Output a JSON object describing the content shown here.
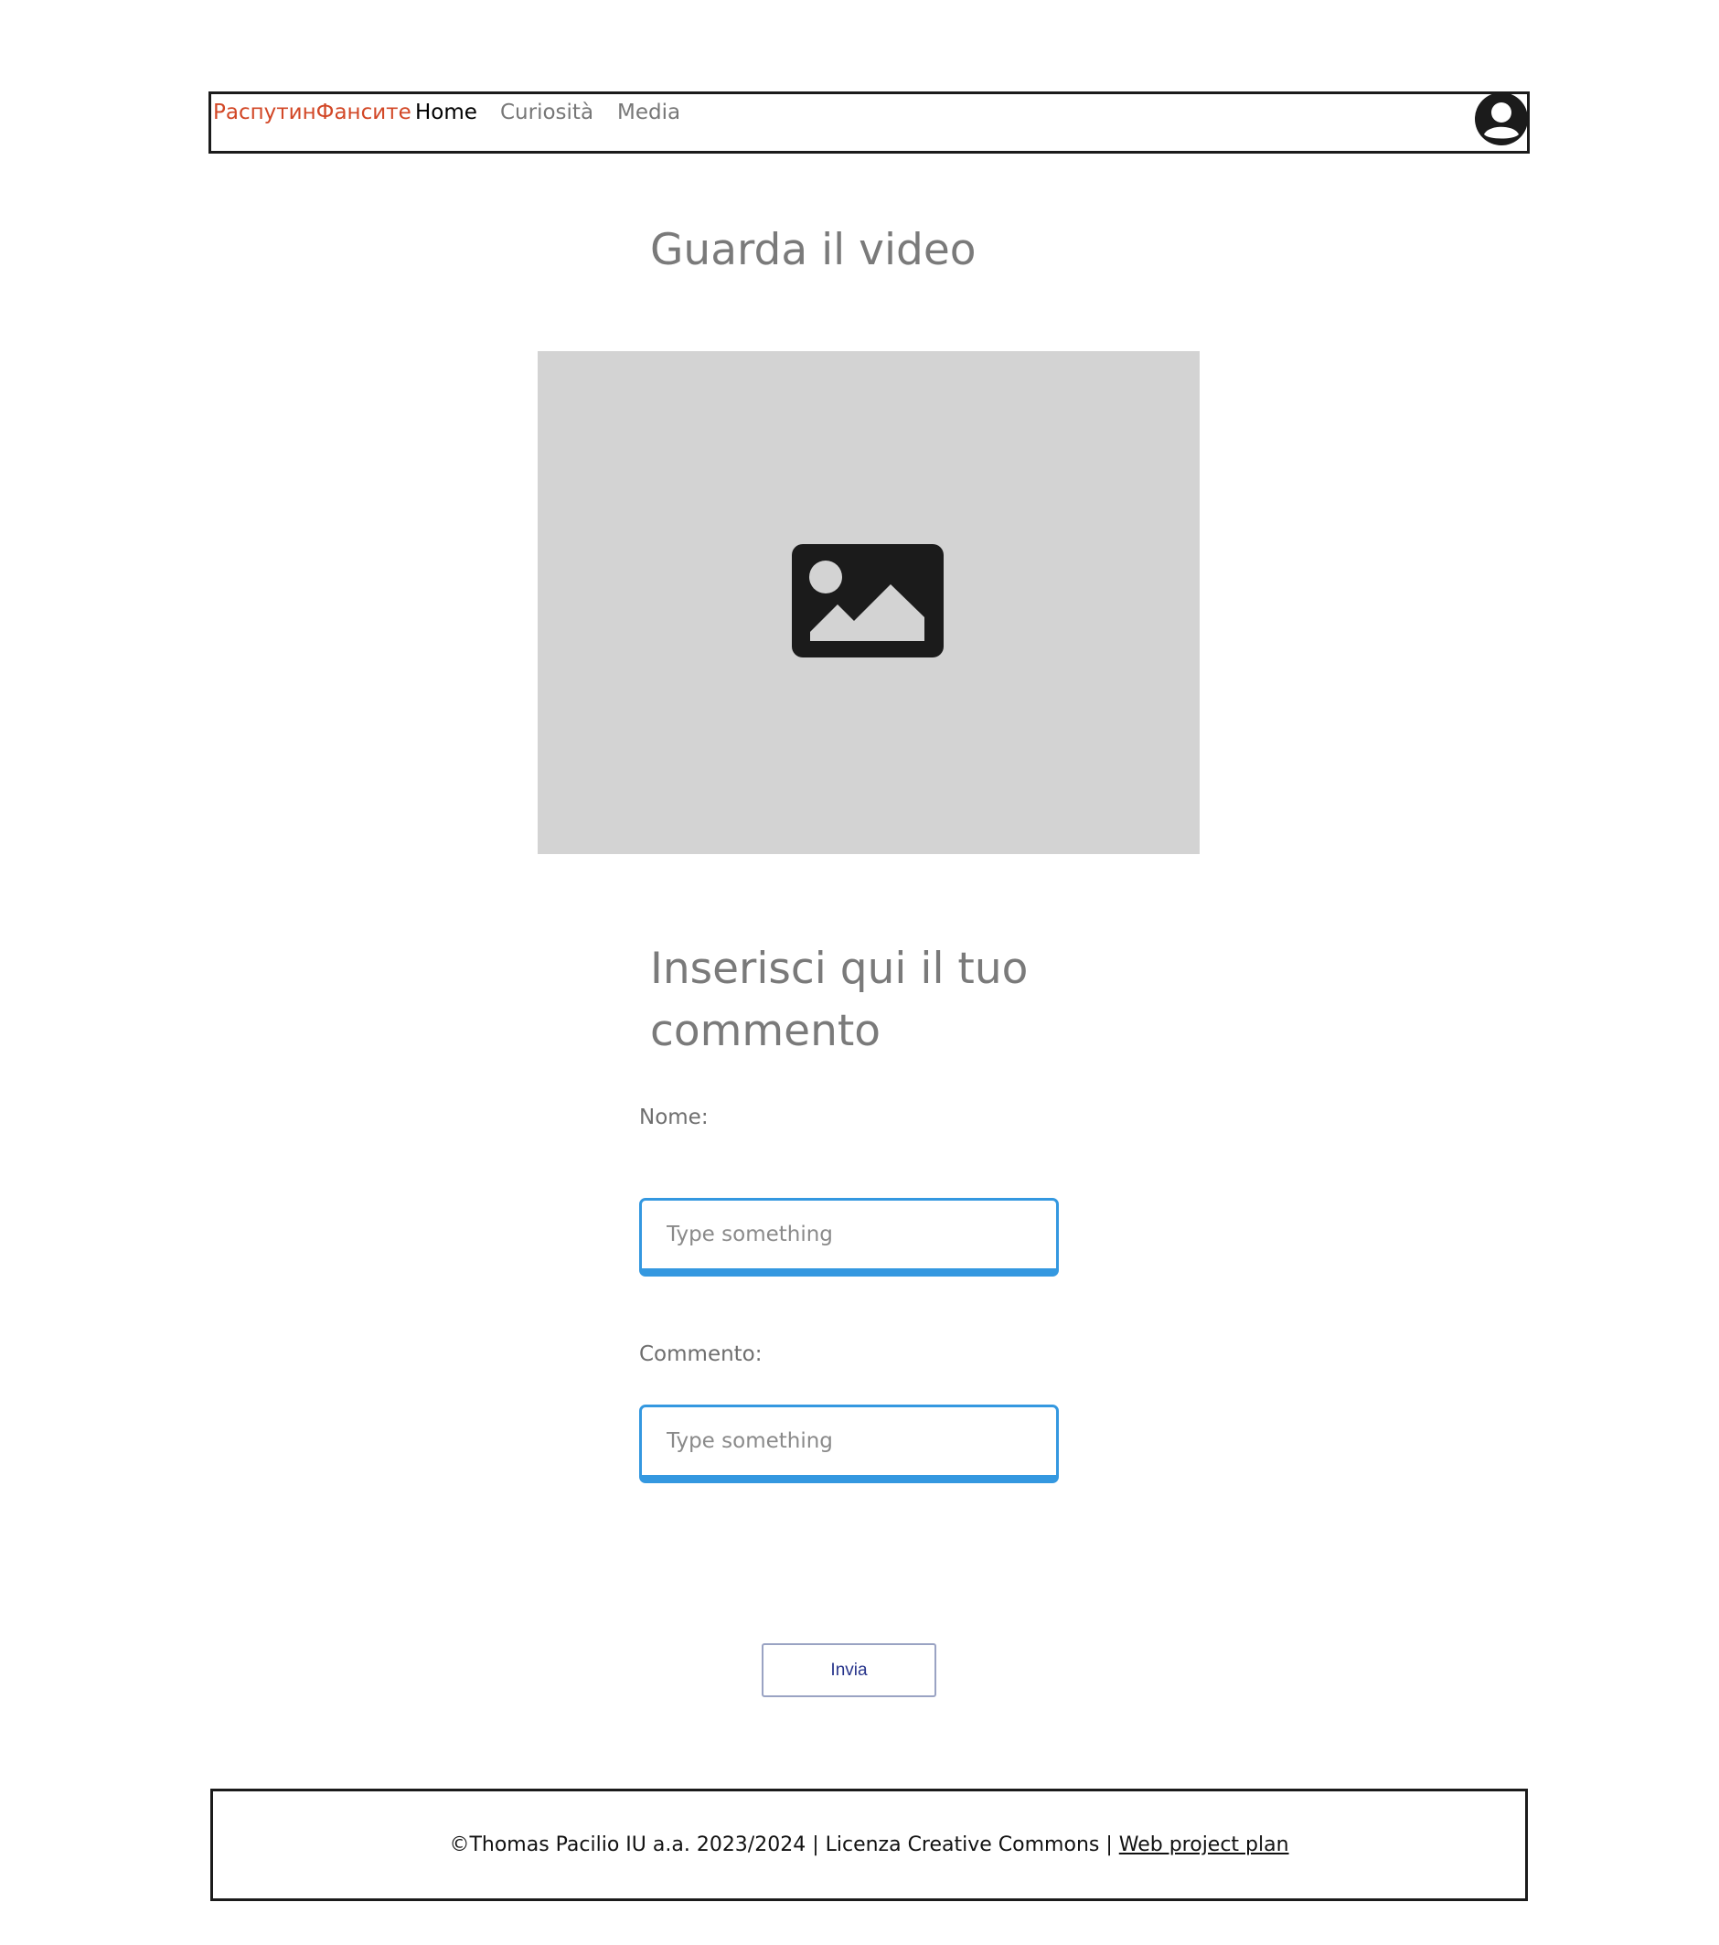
{
  "navbar": {
    "brand": "РаспутинФансите",
    "items": [
      {
        "label": "Home"
      },
      {
        "label": "Curiosità"
      },
      {
        "label": "Media"
      }
    ],
    "avatar_icon": "user-avatar-icon"
  },
  "main": {
    "video_heading": "Guarda il video",
    "video_placeholder_icon": "image-icon",
    "comment_heading": "Inserisci qui il tuo commento"
  },
  "form": {
    "name_label": "Nome:",
    "name_placeholder": "Type something",
    "name_value": "",
    "comment_label": "Commento:",
    "comment_placeholder": "Type something",
    "comment_value": "",
    "submit_label": "Invia"
  },
  "footer": {
    "text": "©Thomas Pacilio IU a.a. 2023/2024 | Licenza Creative Commons | ",
    "link_label": "Web project plan"
  },
  "colors": {
    "brand": "#d24726",
    "field_border": "#3498e0",
    "placeholder_bg": "#d3d3d3",
    "button_text": "#27348b"
  }
}
